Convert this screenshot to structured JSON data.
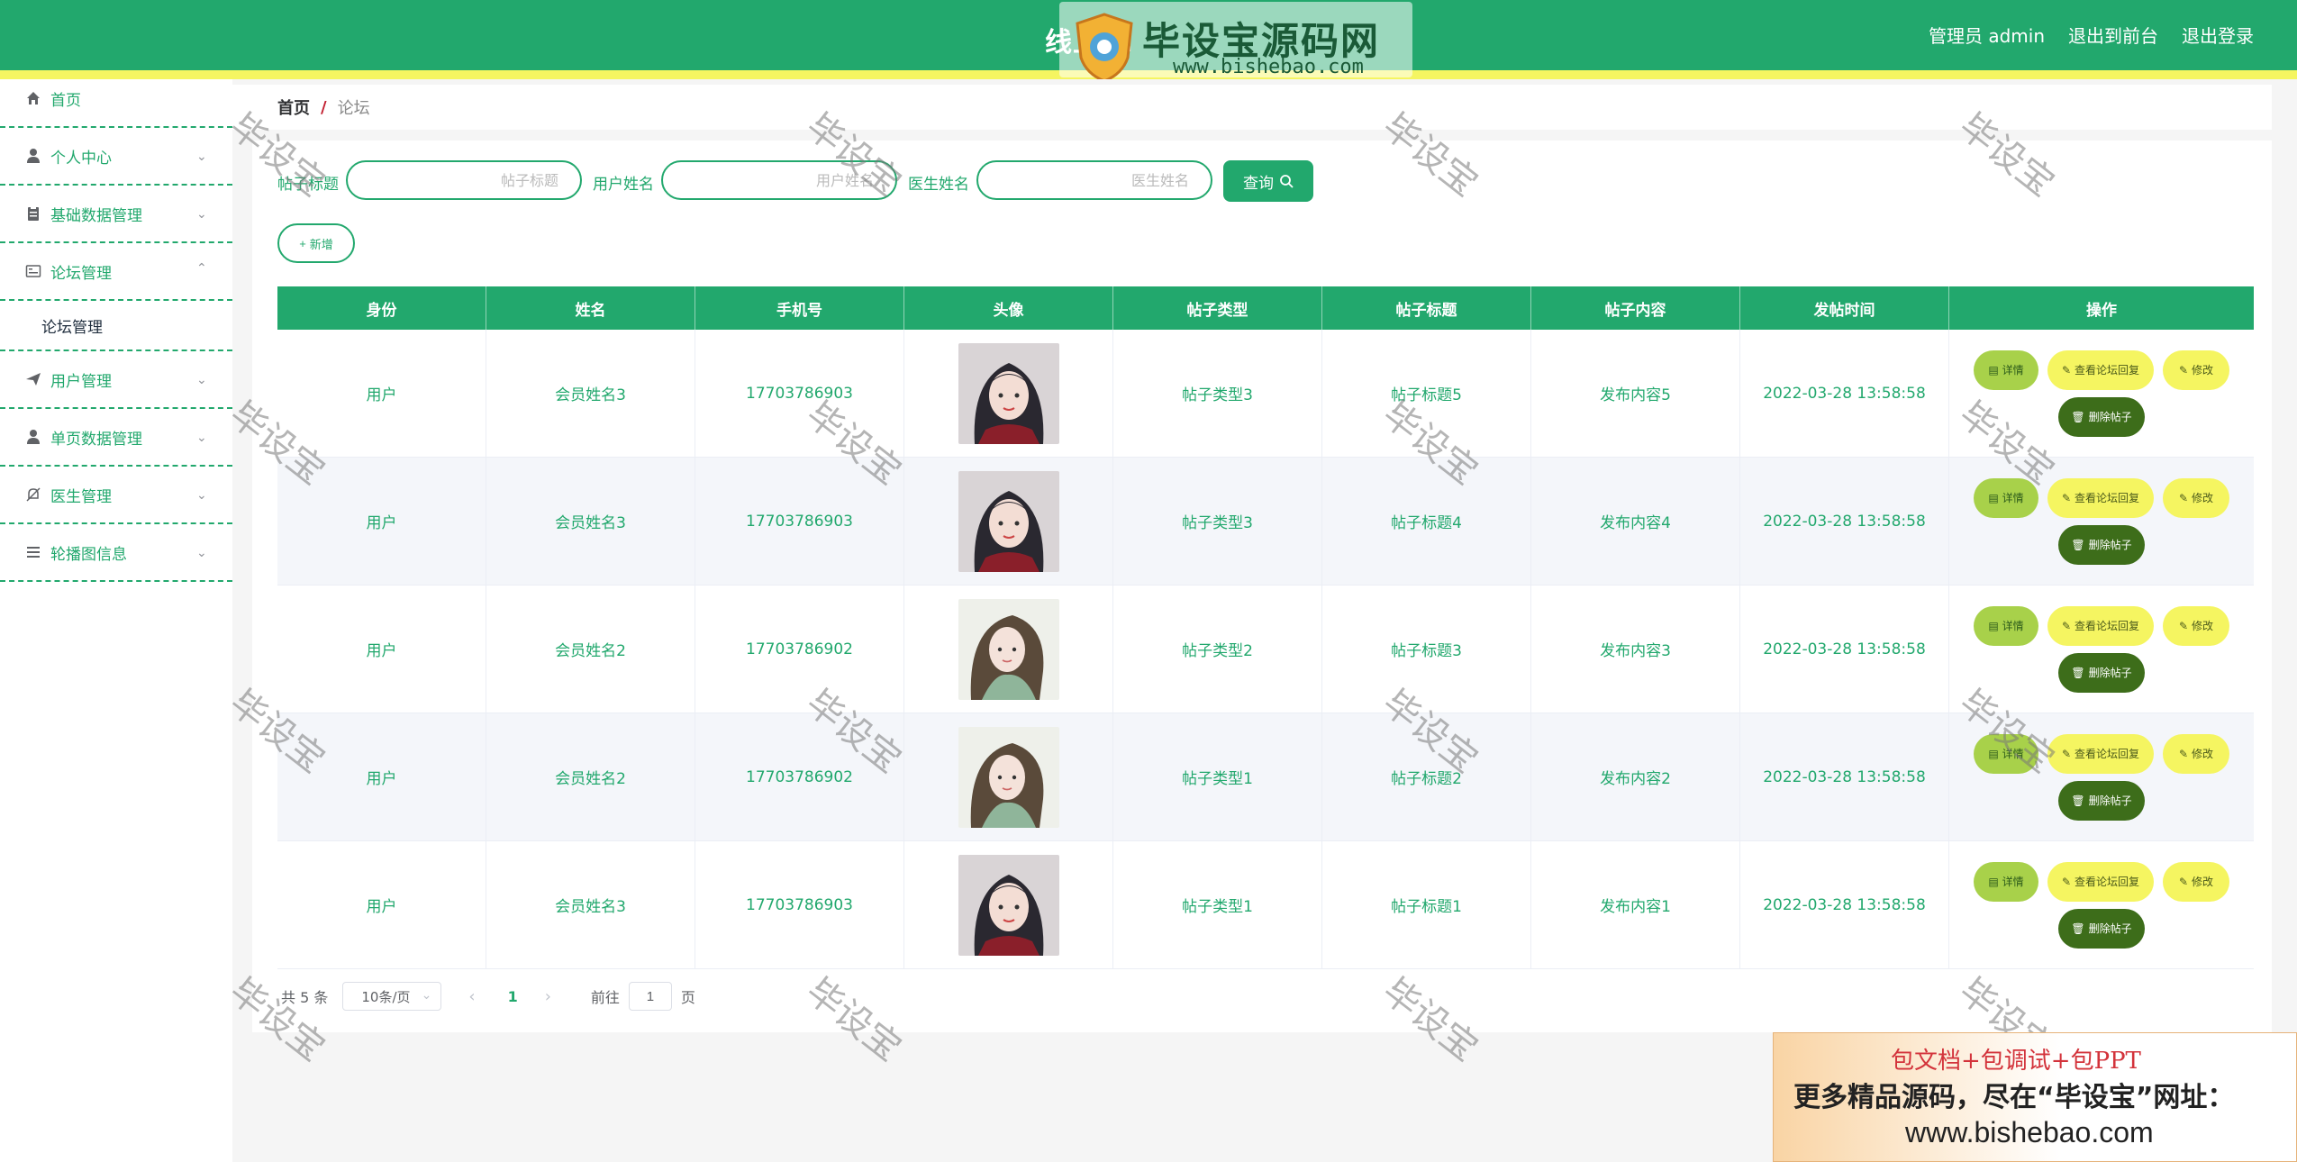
{
  "header": {
    "title": "线上...",
    "admin_label": "管理员 admin",
    "back_label": "退出到前台",
    "logout_label": "退出登录"
  },
  "watermark_logo": {
    "brand": "毕设宝源码网",
    "url": "www.bishebao.com"
  },
  "sidebar": {
    "items": [
      {
        "label": "首页",
        "icon": "home-icon"
      },
      {
        "label": "个人中心",
        "icon": "user-icon"
      },
      {
        "label": "基础数据管理",
        "icon": "clipboard-icon"
      },
      {
        "label": "论坛管理",
        "icon": "forum-icon",
        "expanded": true
      },
      {
        "label": "用户管理",
        "icon": "send-icon"
      },
      {
        "label": "单页数据管理",
        "icon": "user-icon"
      },
      {
        "label": "医生管理",
        "icon": "bell-off-icon"
      },
      {
        "label": "轮播图信息",
        "icon": "list-icon"
      }
    ],
    "submenu": {
      "label": "论坛管理"
    }
  },
  "breadcrumb": {
    "home": "首页",
    "separator": "/",
    "current": "论坛"
  },
  "search": {
    "title_label": "帖子标题",
    "title_placeholder": "帖子标题",
    "user_label": "用户姓名",
    "user_placeholder": "用户姓名",
    "doctor_label": "医生姓名",
    "doctor_placeholder": "医生姓名",
    "query_label": "查询",
    "add_label": "新增"
  },
  "table": {
    "headers": [
      "身份",
      "姓名",
      "手机号",
      "头像",
      "帖子类型",
      "帖子标题",
      "帖子内容",
      "发帖时间",
      "操作"
    ],
    "rows": [
      {
        "role": "用户",
        "name": "会员姓名3",
        "phone": "17703786903",
        "avatar": "avatar-a",
        "type": "帖子类型3",
        "title": "帖子标题5",
        "content": "发布内容5",
        "time": "2022-03-28 13:58:58"
      },
      {
        "role": "用户",
        "name": "会员姓名3",
        "phone": "17703786903",
        "avatar": "avatar-a",
        "type": "帖子类型3",
        "title": "帖子标题4",
        "content": "发布内容4",
        "time": "2022-03-28 13:58:58"
      },
      {
        "role": "用户",
        "name": "会员姓名2",
        "phone": "17703786902",
        "avatar": "avatar-b",
        "type": "帖子类型2",
        "title": "帖子标题3",
        "content": "发布内容3",
        "time": "2022-03-28 13:58:58"
      },
      {
        "role": "用户",
        "name": "会员姓名2",
        "phone": "17703786902",
        "avatar": "avatar-b",
        "type": "帖子类型1",
        "title": "帖子标题2",
        "content": "发布内容2",
        "time": "2022-03-28 13:58:58"
      },
      {
        "role": "用户",
        "name": "会员姓名3",
        "phone": "17703786903",
        "avatar": "avatar-a",
        "type": "帖子类型1",
        "title": "帖子标题1",
        "content": "发布内容1",
        "time": "2022-03-28 13:58:58"
      }
    ],
    "ops": {
      "detail": "详情",
      "view_reply": "查看论坛回复",
      "edit": "修改",
      "delete": "删除帖子"
    }
  },
  "pagination": {
    "total": "共 5 条",
    "page_size": "10条/页",
    "current_page": "1",
    "goto_label": "前往",
    "goto_value": "1",
    "page_unit": "页"
  },
  "watermark_text": "毕设宝",
  "ad_banner": {
    "line1": "包文档+包调试+包PPT",
    "line2": "更多精品源码，尽在“毕设宝”网址：",
    "line3": "www.bishebao.com"
  },
  "colors": {
    "primary": "#22a86d",
    "accent_yellow": "#f5f561",
    "detail_btn": "#a8d14a",
    "delete_btn": "#3d6d1a"
  }
}
